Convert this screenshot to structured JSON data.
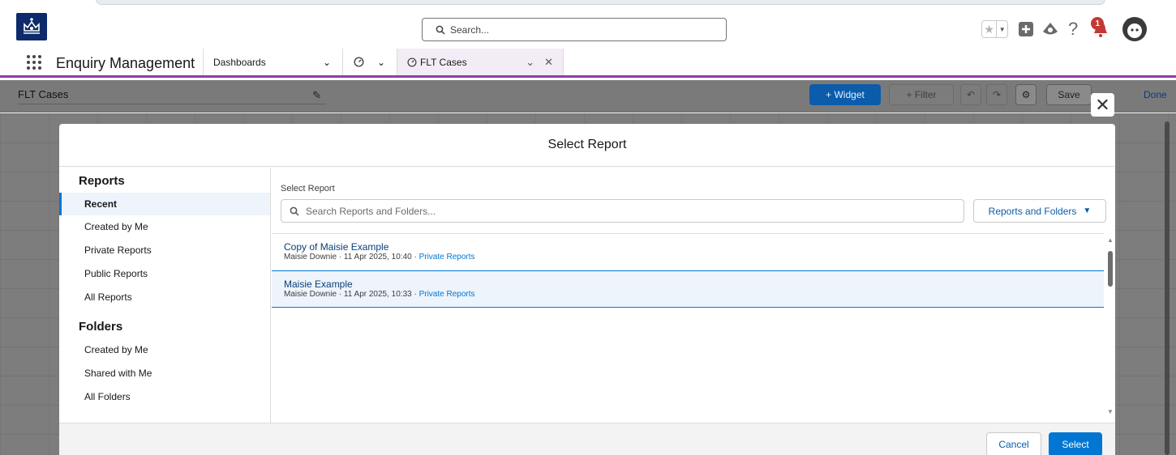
{
  "header": {
    "search_placeholder": "Search...",
    "notification_count": "1",
    "icons": [
      "favorites-star-icon",
      "favorites-menu-icon",
      "global-actions-plus-icon",
      "trailhead-icon",
      "help-icon",
      "notifications-bell-icon",
      "user-avatar-icon"
    ]
  },
  "nav": {
    "app_name": "Enquiry Management",
    "dashboards_label": "Dashboards",
    "active_tab_label": "FLT Cases"
  },
  "dashboard": {
    "title": "FLT Cases",
    "widget_label": "+ Widget",
    "filter_label": "+ Filter",
    "save_label": "Save",
    "done_label": "Done"
  },
  "modal": {
    "title": "Select Report",
    "sidebar": {
      "reports_heading": "Reports",
      "report_items": [
        "Recent",
        "Created by Me",
        "Private Reports",
        "Public Reports",
        "All Reports"
      ],
      "folders_heading": "Folders",
      "folder_items": [
        "Created by Me",
        "Shared with Me",
        "All Folders"
      ]
    },
    "select_label": "Select Report",
    "search_placeholder": "Search Reports and Folders...",
    "filter_dropdown_label": "Reports and Folders",
    "results": [
      {
        "title": "Copy of Maisie Example",
        "meta": "Maisie Downie · 11 Apr 2025, 10:40 · ",
        "folder": "Private Reports",
        "selected": false
      },
      {
        "title": "Maisie Example",
        "meta": "Maisie Downie · 11 Apr 2025, 10:33 · ",
        "folder": "Private Reports",
        "selected": true
      }
    ],
    "cancel_label": "Cancel",
    "select_button_label": "Select"
  },
  "colors": {
    "brand": "#0176d3",
    "app_accent": "#8b3fa5",
    "logo_navy": "#0d2b6b",
    "notification_red": "#c23934"
  }
}
